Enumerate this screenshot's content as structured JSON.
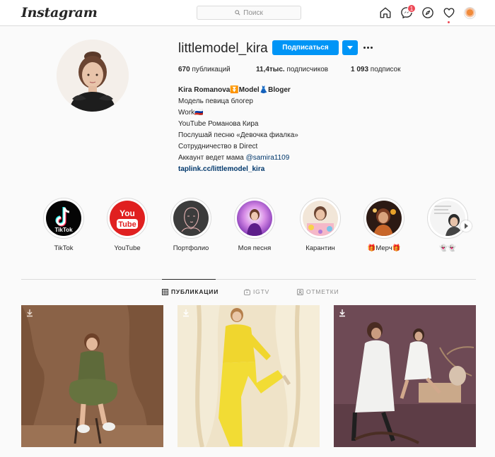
{
  "nav": {
    "logo": "Instagram",
    "search_placeholder": "Поиск",
    "notifications_count": "1"
  },
  "profile": {
    "username": "littlemodel_kira",
    "follow_label": "Подписаться",
    "stats": {
      "posts_value": "670",
      "posts_label": " публикаций",
      "followers_value": "11,4тыс.",
      "followers_label": " подписчиков",
      "following_value": "1 093",
      "following_label": " подписок"
    },
    "bio": {
      "name": "Kira Romanova⏬Model👗Bloger",
      "line1": "Модель певица блогер",
      "line2": "Work🇷🇺",
      "line3": "YouTube Романова Кира",
      "line4": "Послушай песню «Девочка фиалка»",
      "line5": "Сотрудничество в Direct",
      "line6_prefix": "Аккаунт ведет мама ",
      "line6_mention": "@samira1109",
      "link": "taplink.cc/littlemodel_kira"
    }
  },
  "highlights": [
    {
      "label": "TikTok"
    },
    {
      "label": "YouTube"
    },
    {
      "label": "Портфолио"
    },
    {
      "label": "Моя песня"
    },
    {
      "label": "Карантин"
    },
    {
      "label": "🎁Мерч🎁"
    },
    {
      "label": "👻👻"
    }
  ],
  "tabs": {
    "posts": "ПУБЛИКАЦИИ",
    "igtv": "IGTV",
    "tagged": "ОТМЕТКИ"
  },
  "colors": {
    "accent": "#0095f6",
    "link": "#00376b",
    "badge": "#ed4956"
  }
}
